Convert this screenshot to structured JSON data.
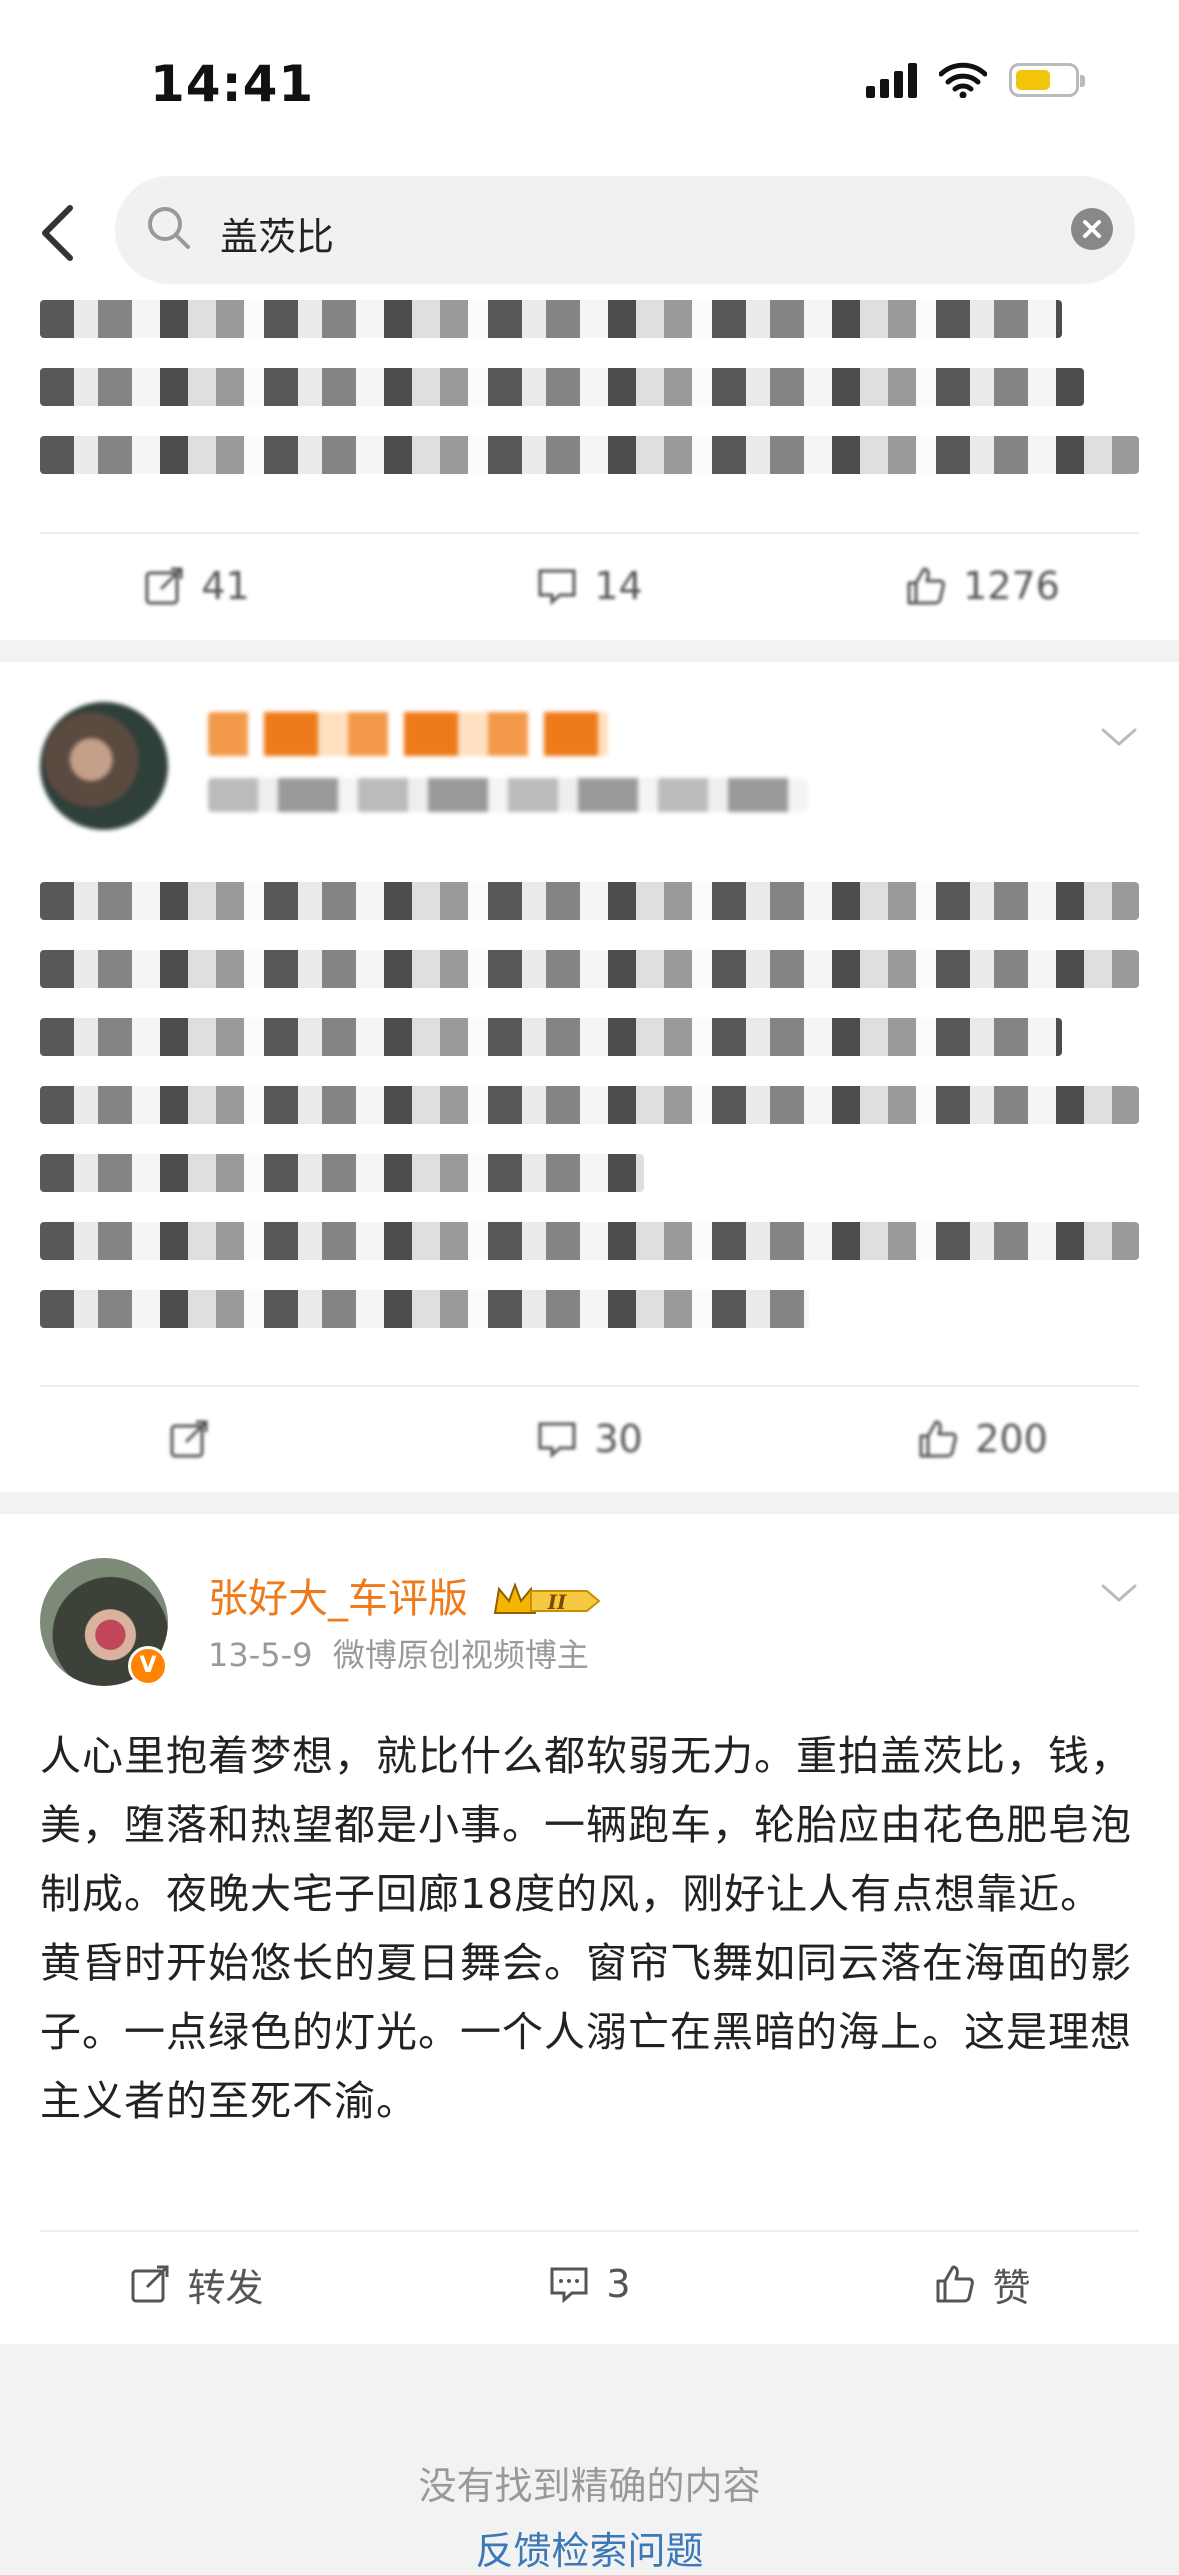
{
  "status_bar": {
    "time": "14:41"
  },
  "search": {
    "query": "盖茨比"
  },
  "card1": {
    "repost_count": "41",
    "comment_count": "14",
    "like_count": "1276"
  },
  "card2": {
    "repost_label": "",
    "comment_count": "30",
    "like_count": "200"
  },
  "post": {
    "username": "张好大_车评版",
    "level_badge": "II",
    "date": "13-5-9",
    "source": "微博原创视频博主",
    "text": "人心里抱着梦想，就比什么都软弱无力。重拍盖茨比，钱，美，堕落和热望都是小事。一辆跑车，轮胎应由花色肥皂泡制成。夜晚大宅子回廊18度的风，刚好让人有点想靠近。黄昏时开始悠长的夏日舞会。窗帘飞舞如同云落在海面的影子。一点绿色的灯光。一个人溺亡在黑暗的海上。这是理想主义者的至死不渝。",
    "repost_label": "转发",
    "comment_count": "3",
    "like_label": "赞"
  },
  "footer": {
    "no_result": "没有找到精确的内容",
    "feedback_link": "反馈检索问题"
  },
  "colors": {
    "accent_orange": "#ee7a1a",
    "link_blue": "#3b78b8",
    "battery_yellow": "#f2c50a"
  }
}
